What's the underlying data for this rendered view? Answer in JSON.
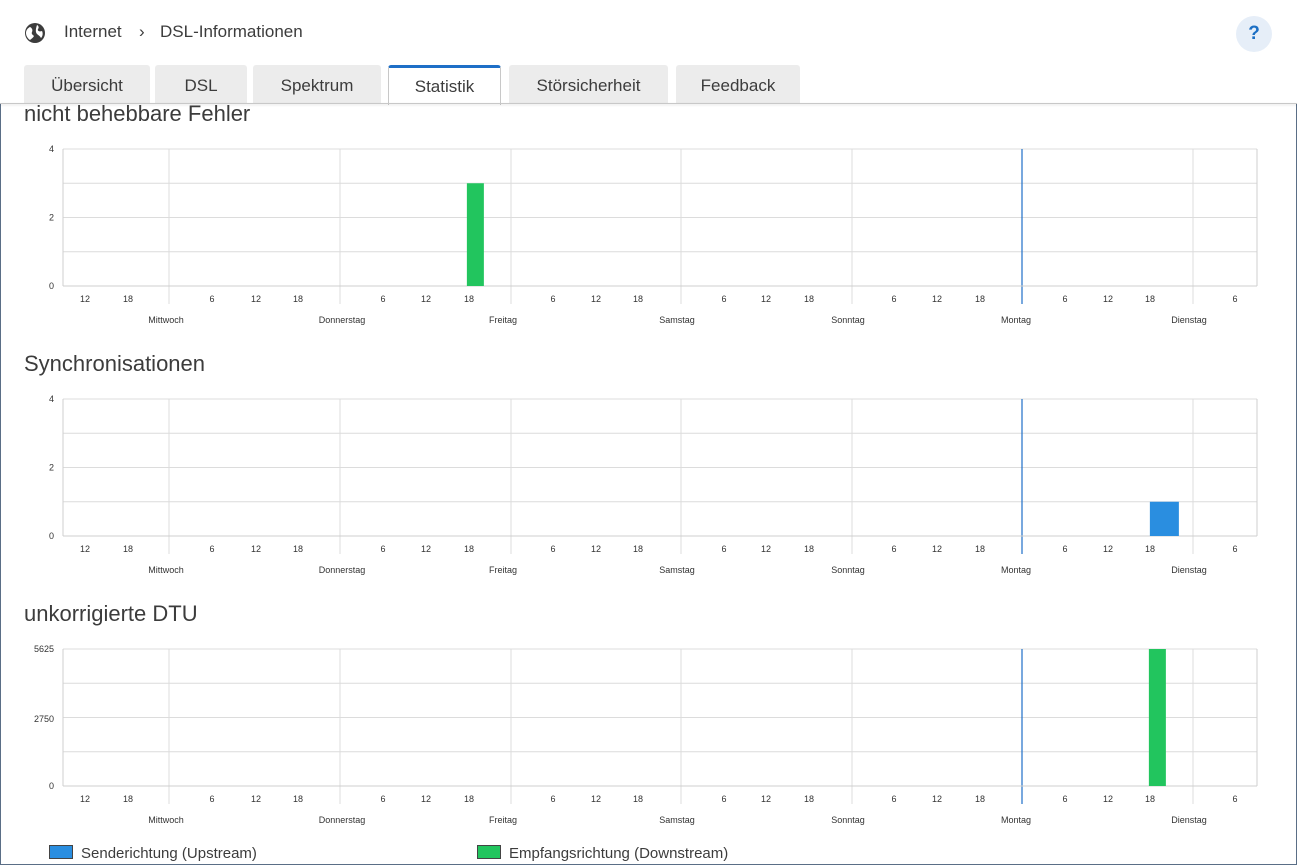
{
  "breadcrumb": {
    "section": "Internet",
    "page": "DSL-Informationen"
  },
  "help_label": "?",
  "tabs": [
    {
      "label": "Übersicht",
      "active": false
    },
    {
      "label": "DSL",
      "active": false
    },
    {
      "label": "Spektrum",
      "active": false
    },
    {
      "label": "Statistik",
      "active": true
    },
    {
      "label": "Störsicherheit",
      "active": false
    },
    {
      "label": "Feedback",
      "active": false
    }
  ],
  "colors": {
    "upstream": "#2a8ee0",
    "downstream": "#22c55e",
    "accent": "#1e6fc7",
    "grid": "#dcdcdc"
  },
  "legend": {
    "upstream": "Senderichtung (Upstream)",
    "downstream": "Empfangsrichtung (Downstream)"
  },
  "chart_data": [
    {
      "type": "bar",
      "title": "nicht behebbare Fehler",
      "ylim": [
        0,
        4
      ],
      "y_ticks": [
        "0",
        "2",
        "4"
      ],
      "x_hour_ticks": [
        "12",
        "18",
        "6",
        "12",
        "18",
        "6",
        "12",
        "18",
        "6",
        "12",
        "18",
        "6",
        "12",
        "18",
        "6",
        "12",
        "18",
        "6",
        "12",
        "18",
        "6"
      ],
      "x_day_labels": [
        "Mittwoch",
        "Donnerstag",
        "Freitag",
        "Samstag",
        "Sonntag",
        "Montag",
        "Dienstag"
      ],
      "series": [
        {
          "name": "Senderichtung (Upstream)",
          "points": []
        },
        {
          "name": "Empfangsrichtung (Downstream)",
          "points": [
            {
              "day": "Donnerstag",
              "hour": 18,
              "value": 3
            }
          ]
        }
      ]
    },
    {
      "type": "bar",
      "title": "Synchronisationen",
      "ylim": [
        0,
        4
      ],
      "y_ticks": [
        "0",
        "2",
        "4"
      ],
      "x_hour_ticks": [
        "12",
        "18",
        "6",
        "12",
        "18",
        "6",
        "12",
        "18",
        "6",
        "12",
        "18",
        "6",
        "12",
        "18",
        "6",
        "12",
        "18",
        "6",
        "12",
        "18",
        "6"
      ],
      "x_day_labels": [
        "Mittwoch",
        "Donnerstag",
        "Freitag",
        "Samstag",
        "Sonntag",
        "Montag",
        "Dienstag"
      ],
      "series": [
        {
          "name": "Senderichtung (Upstream)",
          "points": [
            {
              "day": "Montag",
              "hour": 18,
              "value": 1
            }
          ]
        },
        {
          "name": "Empfangsrichtung (Downstream)",
          "points": []
        }
      ]
    },
    {
      "type": "bar",
      "title": "unkorrigierte DTU",
      "ylim": [
        0,
        5625
      ],
      "y_ticks": [
        "0",
        "2750",
        "5625"
      ],
      "x_hour_ticks": [
        "12",
        "18",
        "6",
        "12",
        "18",
        "6",
        "12",
        "18",
        "6",
        "12",
        "18",
        "6",
        "12",
        "18",
        "6",
        "12",
        "18",
        "6",
        "12",
        "18",
        "6"
      ],
      "x_day_labels": [
        "Mittwoch",
        "Donnerstag",
        "Freitag",
        "Samstag",
        "Sonntag",
        "Montag",
        "Dienstag"
      ],
      "series": [
        {
          "name": "Senderichtung (Upstream)",
          "points": []
        },
        {
          "name": "Empfangsrichtung (Downstream)",
          "points": [
            {
              "day": "Montag",
              "hour": 18,
              "value": 5625
            }
          ]
        }
      ]
    }
  ]
}
